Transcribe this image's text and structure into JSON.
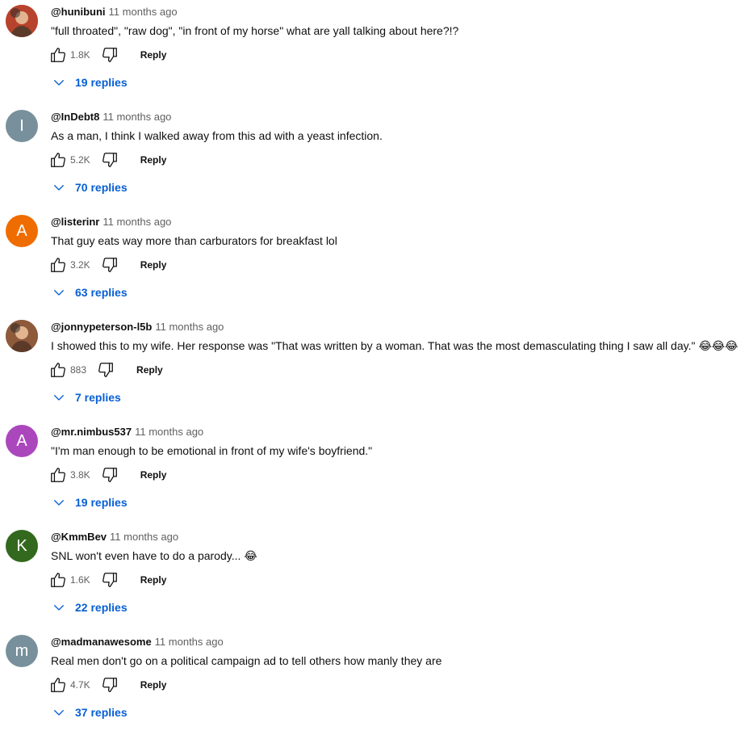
{
  "comments": [
    {
      "author": "@hunibuni",
      "time": "11 months ago",
      "text": "\"full throated\", \"raw dog\", \"in front of my horse\" what are yall talking about here?!?",
      "emoji": "",
      "likes": "1.8K",
      "reply_label": "Reply",
      "replies_label": "19 replies",
      "avatar": {
        "type": "photo",
        "color": "#b8432c"
      }
    },
    {
      "author": "@InDebt8",
      "time": "11 months ago",
      "text": "As a man, I think I walked away from this ad with a yeast infection.",
      "emoji": "",
      "likes": "5.2K",
      "reply_label": "Reply",
      "replies_label": "70 replies",
      "avatar": {
        "type": "letter",
        "letter": "I",
        "color": "#78909c"
      }
    },
    {
      "author": "@listerinr",
      "time": "11 months ago",
      "text": "That guy eats way more than carburators for breakfast lol",
      "emoji": "",
      "likes": "3.2K",
      "reply_label": "Reply",
      "replies_label": "63 replies",
      "avatar": {
        "type": "letter",
        "letter": "A",
        "color": "#ef6c00"
      }
    },
    {
      "author": "@jonnypeterson-l5b",
      "time": "11 months ago",
      "text": "I showed this to my wife. Her response was \"That was written by a woman. That was the most demasculating thing I saw all day.\"",
      "emoji": "😂😂😂",
      "likes": "883",
      "reply_label": "Reply",
      "replies_label": "7 replies",
      "avatar": {
        "type": "photo",
        "color": "#8d5a3b"
      }
    },
    {
      "author": "@mr.nimbus537",
      "time": "11 months ago",
      "text": "\"I'm man enough to be emotional in front of my wife's boyfriend.\"",
      "emoji": "",
      "likes": "3.8K",
      "reply_label": "Reply",
      "replies_label": "19 replies",
      "avatar": {
        "type": "letter",
        "letter": "A",
        "color": "#ab47bc"
      }
    },
    {
      "author": "@KmmBev",
      "time": "11 months ago",
      "text": "SNL won't even have to do a parody...",
      "emoji": "😂",
      "likes": "1.6K",
      "reply_label": "Reply",
      "replies_label": "22 replies",
      "avatar": {
        "type": "letter",
        "letter": "K",
        "color": "#33691e"
      }
    },
    {
      "author": "@madmanawesome",
      "time": "11 months ago",
      "text": "Real men don't go on a political campaign ad to tell others how manly they are",
      "emoji": "",
      "likes": "4.7K",
      "reply_label": "Reply",
      "replies_label": "37 replies",
      "avatar": {
        "type": "letter",
        "letter": "m",
        "color": "#78909c"
      }
    }
  ],
  "icons": {
    "like": "thumb-up-icon",
    "dislike": "thumb-down-icon",
    "expand": "chevron-down-icon"
  },
  "colors": {
    "link_blue": "#065fd4",
    "secondary_text": "#606060",
    "primary_text": "#0f0f0f"
  }
}
